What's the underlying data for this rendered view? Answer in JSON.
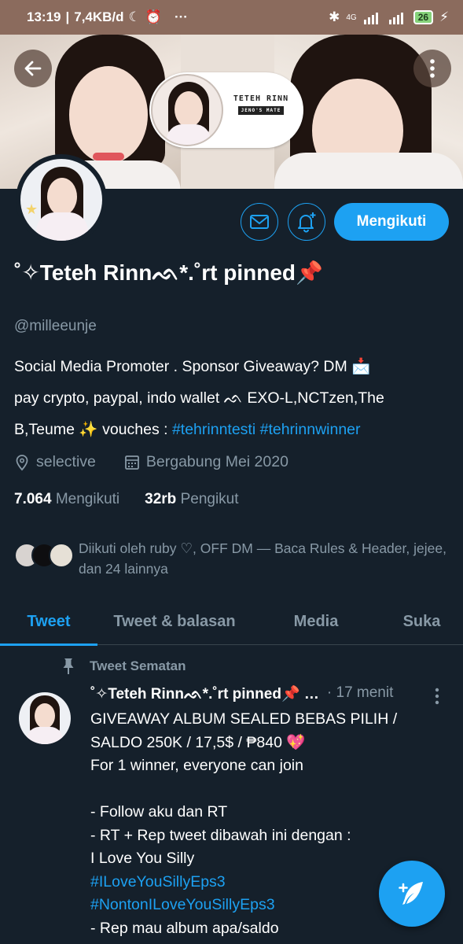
{
  "status_bar": {
    "time": "13:19",
    "speed": "7,4KB/d",
    "network": "4G",
    "battery": "26"
  },
  "header": {
    "back_icon": "arrow-left-icon",
    "more_icon": "more-vertical-icon",
    "banner_name": "TETEH RINN",
    "banner_sub": "JENO'S MATE"
  },
  "actions": {
    "message_icon": "envelope-icon",
    "notify_icon": "bell-plus-icon",
    "follow_label": "Mengikuti"
  },
  "profile": {
    "display_name": "˚✧Teteh Rinnᨒ*.˚rt pinned📌",
    "handle": "@milleeunje",
    "bio_line1": "Social Media Promoter . Sponsor Giveaway? DM 📩",
    "bio_line2": "pay crypto, paypal, indo wallet ᨒ EXO-L,NCTzen,The",
    "bio_line3_prefix": "B,Teume ✨ vouches : ",
    "bio_tag1": "#tehrinntesti",
    "bio_tag2": "#tehrinnwinner",
    "location": "selective",
    "joined": "Bergabung Mei 2020",
    "following_count": "7.064",
    "following_label": "Mengikuti",
    "followers_count": "32rb",
    "followers_label": "Pengikut",
    "followed_by": "Diikuti oleh ruby ♡, OFF DM — Baca Rules & Header, jejee, dan 24 lainnya"
  },
  "tabs": [
    "Tweet",
    "Tweet & balasan",
    "Media",
    "Suka"
  ],
  "tweet": {
    "pinned_label": "Tweet Sematan",
    "author": "˚✧Teteh Rinnᨒ*.˚rt pinned📌 …",
    "time": "· 17 menit",
    "lines": [
      "GIVEAWAY ALBUM SEALED BEBAS PILIH /",
      "SALDO 250K / 17,5$ / ₱840 💖",
      "For 1 winner, everyone can join",
      "",
      "- Follow aku dan RT",
      "- RT + Rep tweet dibawah ini dengan :",
      "I Love You Silly"
    ],
    "hashtag1": "#ILoveYouSillyEps3",
    "hashtag2": "#NontonILoveYouSillyEps3",
    "last_line": "- Rep mau album apa/saldo"
  },
  "fab": {
    "icon": "compose-feather-icon"
  },
  "colors": {
    "accent": "#1da1f2",
    "background": "#15202b",
    "muted": "#8899a6"
  }
}
